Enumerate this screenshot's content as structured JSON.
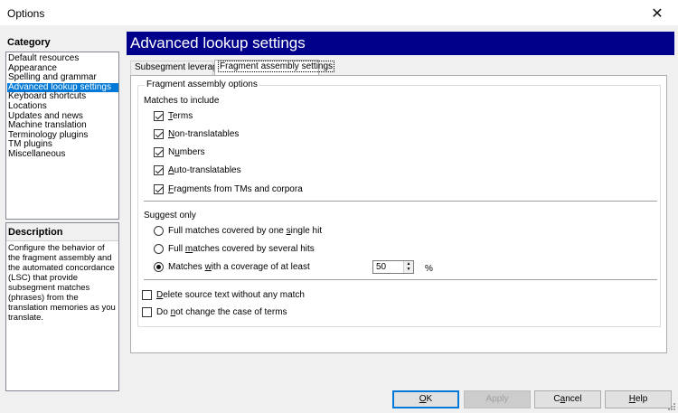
{
  "window": {
    "title": "Options"
  },
  "category": {
    "label": "Category",
    "items": [
      "Default resources",
      "Appearance",
      "Spelling and grammar",
      "Advanced lookup settings",
      "Keyboard shortcuts",
      "Locations",
      "Updates and news",
      "Machine translation",
      "Terminology plugins",
      "TM plugins",
      "Miscellaneous"
    ],
    "selected_index": 3
  },
  "description": {
    "title": "Description",
    "text": "Configure the behavior of the fragment assembly and the automated concordance (LSC) that provide subsegment matches (phrases) from the translation memories as you translate."
  },
  "page": {
    "title": "Advanced lookup settings"
  },
  "tabs": [
    {
      "label": "Subsegment leverage",
      "active": false
    },
    {
      "label": "Fragment assembly settings",
      "active": true
    }
  ],
  "fragment_assembly": {
    "legend": "Fragment assembly options",
    "matches_label": "Matches to include",
    "matches": {
      "terms": {
        "pre": "",
        "key": "T",
        "post": "erms",
        "checked": true
      },
      "non_translatables": {
        "pre": "",
        "key": "N",
        "post": "on-translatables",
        "checked": true
      },
      "numbers": {
        "pre": "N",
        "key": "u",
        "post": "mbers",
        "checked": true
      },
      "auto_translatables": {
        "pre": "",
        "key": "A",
        "post": "uto-translatables",
        "checked": true
      },
      "fragments": {
        "pre": "",
        "key": "F",
        "post": "ragments from TMs and corpora",
        "checked": true
      }
    },
    "suggest_label": "Suggest only",
    "suggest": {
      "one_hit": {
        "pre": "Full matches covered by one ",
        "key": "s",
        "post": "ingle hit",
        "selected": false
      },
      "several_hits": {
        "pre": "Full ",
        "key": "m",
        "post": "atches covered by several hits",
        "selected": false
      },
      "coverage": {
        "pre": "Matches ",
        "key": "w",
        "post": "ith a coverage of at least",
        "selected": true
      }
    },
    "coverage_value": "50",
    "coverage_unit": "%",
    "delete_source": {
      "pre": "",
      "key": "D",
      "post": "elete source text without any match",
      "checked": false
    },
    "no_case_change": {
      "pre": "Do ",
      "key": "n",
      "post": "ot change the case of terms",
      "checked": false
    }
  },
  "buttons": {
    "ok": {
      "key": "O",
      "post": "K"
    },
    "apply": "Apply",
    "cancel": {
      "pre": "C",
      "key": "a",
      "post": "ncel"
    },
    "help": {
      "key": "H",
      "post": "elp"
    }
  },
  "icons": {
    "close": "close-icon",
    "grip": "resize-grip-icon",
    "spin_up": "arrow-up-icon",
    "spin_down": "arrow-down-icon"
  }
}
